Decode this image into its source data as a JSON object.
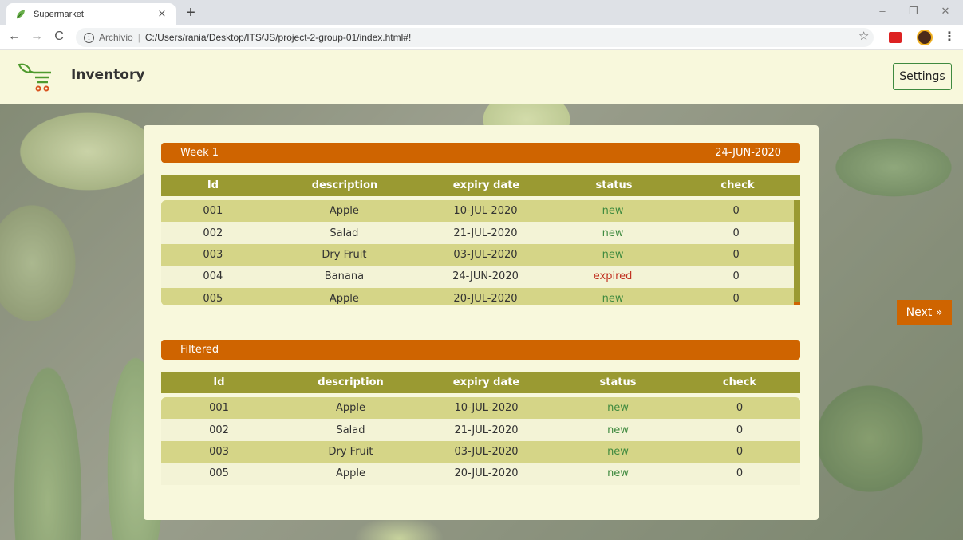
{
  "browser": {
    "tab_title": "Supermarket",
    "tab_close": "×",
    "new_tab": "+",
    "win_minimize": "–",
    "win_restore": "❐",
    "win_close": "✕",
    "back": "←",
    "forward": "→",
    "reload": "C",
    "address_scheme": "Archivio",
    "address_sep": "|",
    "address_url": "C:/Users/rania/Desktop/ITS/JS/project-2-group-01/index.html#!",
    "star": "☆",
    "menu": "⋮"
  },
  "app": {
    "title": "Inventory",
    "settings_label": "Settings",
    "next_label": "Next »",
    "colors": {
      "accent": "#cf6400",
      "header_green": "#9a9a32",
      "row_odd": "#d5d587",
      "row_even": "#f3f3d6",
      "new": "#3f8a3f",
      "expired": "#c03020"
    }
  },
  "week": {
    "label": "Week 1",
    "date": "24-JUN-2020",
    "columns": [
      "Id",
      "description",
      "expiry date",
      "status",
      "check"
    ],
    "rows": [
      {
        "id": "001",
        "description": "Apple",
        "expiry": "10-JUL-2020",
        "status": "new",
        "check": "0"
      },
      {
        "id": "002",
        "description": "Salad",
        "expiry": "21-JUL-2020",
        "status": "new",
        "check": "0"
      },
      {
        "id": "003",
        "description": "Dry Fruit",
        "expiry": "03-JUL-2020",
        "status": "new",
        "check": "0"
      },
      {
        "id": "004",
        "description": "Banana",
        "expiry": "24-JUN-2020",
        "status": "expired",
        "check": "0"
      },
      {
        "id": "005",
        "description": "Apple",
        "expiry": "20-JUL-2020",
        "status": "new",
        "check": "0"
      }
    ]
  },
  "filtered": {
    "label": "Filtered",
    "columns": [
      "Id",
      "description",
      "expiry date",
      "status",
      "check"
    ],
    "rows": [
      {
        "id": "001",
        "description": "Apple",
        "expiry": "10-JUL-2020",
        "status": "new",
        "check": "0"
      },
      {
        "id": "002",
        "description": "Salad",
        "expiry": "21-JUL-2020",
        "status": "new",
        "check": "0"
      },
      {
        "id": "003",
        "description": "Dry Fruit",
        "expiry": "03-JUL-2020",
        "status": "new",
        "check": "0"
      },
      {
        "id": "005",
        "description": "Apple",
        "expiry": "20-JUL-2020",
        "status": "new",
        "check": "0"
      }
    ]
  }
}
